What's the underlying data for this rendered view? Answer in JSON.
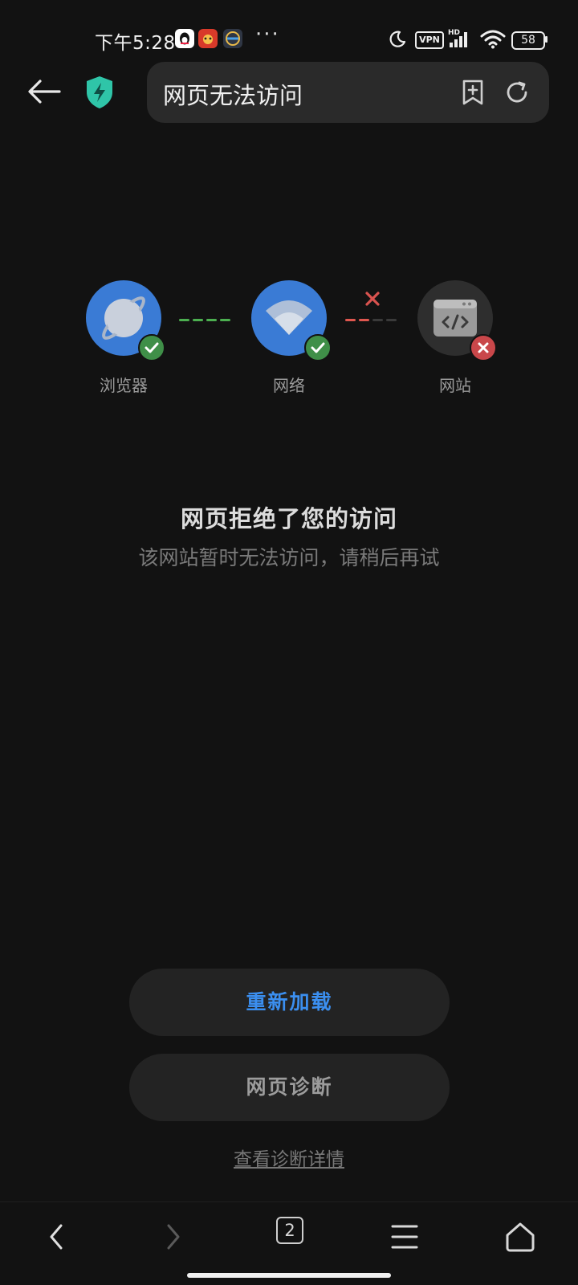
{
  "status_bar": {
    "time": "下午5:28",
    "overflow": "···",
    "vpn": "VPN",
    "signal_label": "HD",
    "battery": "58",
    "icons": [
      "qq-notification-icon",
      "app-notification-icon",
      "app-notification-icon-2",
      "moon-icon",
      "signal-icon",
      "wifi-icon"
    ]
  },
  "toolbar": {
    "url_title": "网页无法访问",
    "back_icon": "back-arrow-icon",
    "shield_icon": "shield-bolt-icon",
    "bookmark_icon": "add-bookmark-icon",
    "refresh_icon": "refresh-icon"
  },
  "diagram": {
    "nodes": [
      {
        "label": "浏览器",
        "status": "ok",
        "icon": "planet-icon"
      },
      {
        "label": "网络",
        "status": "ok",
        "icon": "wifi-icon"
      },
      {
        "label": "网站",
        "status": "error",
        "icon": "code-window-icon"
      }
    ],
    "colors": {
      "ok": "#3f8f48",
      "error": "#c9474a",
      "node": "#3a7bd5",
      "dash_ok": "#4caf50",
      "dash_err": "#e0574f"
    }
  },
  "message": {
    "title": "网页拒绝了您的访问",
    "subtitle": "该网站暂时无法访问，请稍后再试"
  },
  "actions": {
    "reload": "重新加载",
    "diagnose": "网页诊断",
    "details": "查看诊断详情"
  },
  "bottom_nav": {
    "tab_count": "2",
    "items": [
      "back-icon",
      "forward-icon",
      "tabs-icon",
      "menu-icon",
      "home-icon"
    ]
  }
}
